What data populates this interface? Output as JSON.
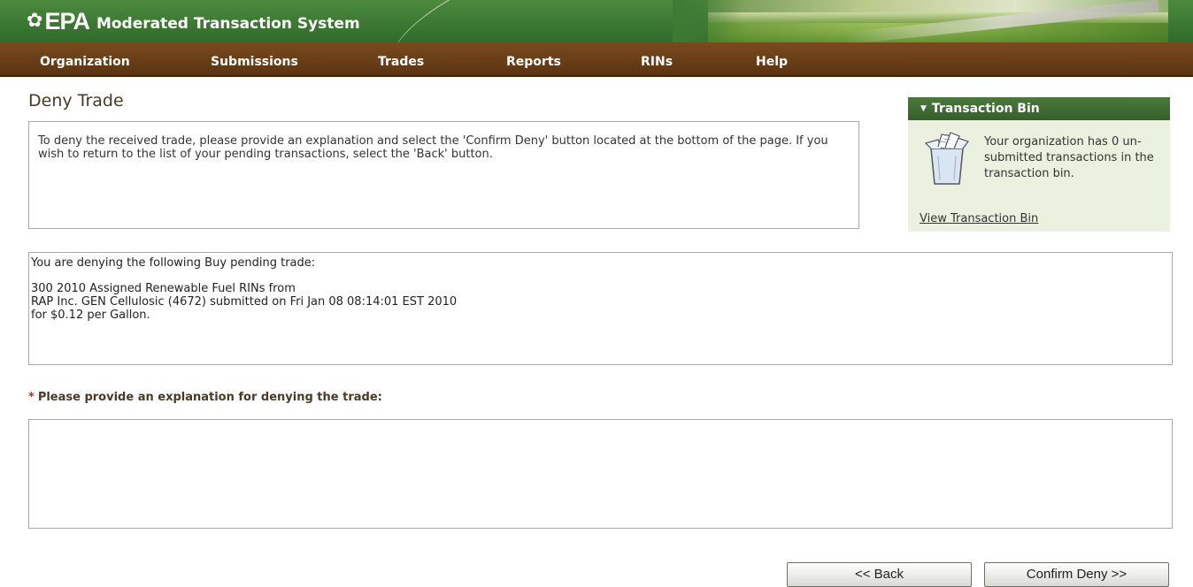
{
  "header": {
    "logo_text": "EPA",
    "system_name": "Moderated Transaction System"
  },
  "nav": {
    "items": [
      {
        "label": "Organization"
      },
      {
        "label": "Submissions"
      },
      {
        "label": "Trades"
      },
      {
        "label": "Reports"
      },
      {
        "label": "RINs"
      },
      {
        "label": "Help"
      }
    ]
  },
  "page": {
    "title": "Deny Trade",
    "instructions": "To deny the received trade, please provide an explanation and select the 'Confirm Deny' button located at the bottom of the page. If you wish to return to the list of your pending transactions, select the 'Back' button."
  },
  "trade": {
    "intro": "You are denying the following Buy pending trade:",
    "line1": "300 2010 Assigned Renewable Fuel RINs from",
    "line2": "RAP Inc. GEN Cellulosic (4672) submitted on Fri Jan 08 08:14:01 EST 2010",
    "line3": "for $0.12 per Gallon."
  },
  "sidebar": {
    "bin_title": "Transaction Bin",
    "bin_message": "Your organization has 0 un-submitted transactions in the transaction bin.",
    "bin_link": "View Transaction Bin"
  },
  "explanation": {
    "required_marker": "*",
    "label": "Please provide an explanation for denying the trade:",
    "value": ""
  },
  "buttons": {
    "back": "<< Back",
    "confirm": "Confirm Deny >>"
  },
  "colors": {
    "header_green": "#2f6b2a",
    "nav_brown": "#6a3f18",
    "sidebar_bg": "#eaf2df",
    "required_red": "#cc2222"
  }
}
